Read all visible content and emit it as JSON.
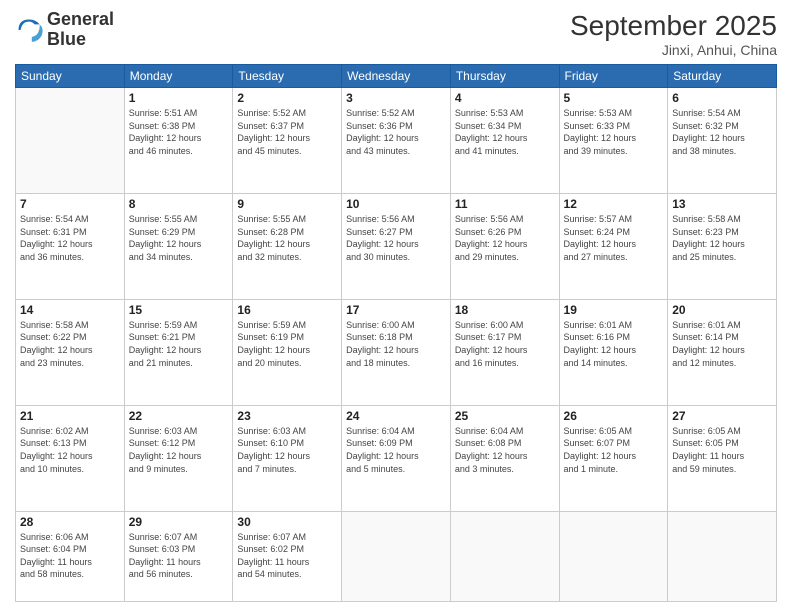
{
  "logo": {
    "line1": "General",
    "line2": "Blue"
  },
  "title": "September 2025",
  "subtitle": "Jinxi, Anhui, China",
  "days_of_week": [
    "Sunday",
    "Monday",
    "Tuesday",
    "Wednesday",
    "Thursday",
    "Friday",
    "Saturday"
  ],
  "weeks": [
    [
      {
        "day": "",
        "info": ""
      },
      {
        "day": "1",
        "info": "Sunrise: 5:51 AM\nSunset: 6:38 PM\nDaylight: 12 hours\nand 46 minutes."
      },
      {
        "day": "2",
        "info": "Sunrise: 5:52 AM\nSunset: 6:37 PM\nDaylight: 12 hours\nand 45 minutes."
      },
      {
        "day": "3",
        "info": "Sunrise: 5:52 AM\nSunset: 6:36 PM\nDaylight: 12 hours\nand 43 minutes."
      },
      {
        "day": "4",
        "info": "Sunrise: 5:53 AM\nSunset: 6:34 PM\nDaylight: 12 hours\nand 41 minutes."
      },
      {
        "day": "5",
        "info": "Sunrise: 5:53 AM\nSunset: 6:33 PM\nDaylight: 12 hours\nand 39 minutes."
      },
      {
        "day": "6",
        "info": "Sunrise: 5:54 AM\nSunset: 6:32 PM\nDaylight: 12 hours\nand 38 minutes."
      }
    ],
    [
      {
        "day": "7",
        "info": "Sunrise: 5:54 AM\nSunset: 6:31 PM\nDaylight: 12 hours\nand 36 minutes."
      },
      {
        "day": "8",
        "info": "Sunrise: 5:55 AM\nSunset: 6:29 PM\nDaylight: 12 hours\nand 34 minutes."
      },
      {
        "day": "9",
        "info": "Sunrise: 5:55 AM\nSunset: 6:28 PM\nDaylight: 12 hours\nand 32 minutes."
      },
      {
        "day": "10",
        "info": "Sunrise: 5:56 AM\nSunset: 6:27 PM\nDaylight: 12 hours\nand 30 minutes."
      },
      {
        "day": "11",
        "info": "Sunrise: 5:56 AM\nSunset: 6:26 PM\nDaylight: 12 hours\nand 29 minutes."
      },
      {
        "day": "12",
        "info": "Sunrise: 5:57 AM\nSunset: 6:24 PM\nDaylight: 12 hours\nand 27 minutes."
      },
      {
        "day": "13",
        "info": "Sunrise: 5:58 AM\nSunset: 6:23 PM\nDaylight: 12 hours\nand 25 minutes."
      }
    ],
    [
      {
        "day": "14",
        "info": "Sunrise: 5:58 AM\nSunset: 6:22 PM\nDaylight: 12 hours\nand 23 minutes."
      },
      {
        "day": "15",
        "info": "Sunrise: 5:59 AM\nSunset: 6:21 PM\nDaylight: 12 hours\nand 21 minutes."
      },
      {
        "day": "16",
        "info": "Sunrise: 5:59 AM\nSunset: 6:19 PM\nDaylight: 12 hours\nand 20 minutes."
      },
      {
        "day": "17",
        "info": "Sunrise: 6:00 AM\nSunset: 6:18 PM\nDaylight: 12 hours\nand 18 minutes."
      },
      {
        "day": "18",
        "info": "Sunrise: 6:00 AM\nSunset: 6:17 PM\nDaylight: 12 hours\nand 16 minutes."
      },
      {
        "day": "19",
        "info": "Sunrise: 6:01 AM\nSunset: 6:16 PM\nDaylight: 12 hours\nand 14 minutes."
      },
      {
        "day": "20",
        "info": "Sunrise: 6:01 AM\nSunset: 6:14 PM\nDaylight: 12 hours\nand 12 minutes."
      }
    ],
    [
      {
        "day": "21",
        "info": "Sunrise: 6:02 AM\nSunset: 6:13 PM\nDaylight: 12 hours\nand 10 minutes."
      },
      {
        "day": "22",
        "info": "Sunrise: 6:03 AM\nSunset: 6:12 PM\nDaylight: 12 hours\nand 9 minutes."
      },
      {
        "day": "23",
        "info": "Sunrise: 6:03 AM\nSunset: 6:10 PM\nDaylight: 12 hours\nand 7 minutes."
      },
      {
        "day": "24",
        "info": "Sunrise: 6:04 AM\nSunset: 6:09 PM\nDaylight: 12 hours\nand 5 minutes."
      },
      {
        "day": "25",
        "info": "Sunrise: 6:04 AM\nSunset: 6:08 PM\nDaylight: 12 hours\nand 3 minutes."
      },
      {
        "day": "26",
        "info": "Sunrise: 6:05 AM\nSunset: 6:07 PM\nDaylight: 12 hours\nand 1 minute."
      },
      {
        "day": "27",
        "info": "Sunrise: 6:05 AM\nSunset: 6:05 PM\nDaylight: 11 hours\nand 59 minutes."
      }
    ],
    [
      {
        "day": "28",
        "info": "Sunrise: 6:06 AM\nSunset: 6:04 PM\nDaylight: 11 hours\nand 58 minutes."
      },
      {
        "day": "29",
        "info": "Sunrise: 6:07 AM\nSunset: 6:03 PM\nDaylight: 11 hours\nand 56 minutes."
      },
      {
        "day": "30",
        "info": "Sunrise: 6:07 AM\nSunset: 6:02 PM\nDaylight: 11 hours\nand 54 minutes."
      },
      {
        "day": "",
        "info": ""
      },
      {
        "day": "",
        "info": ""
      },
      {
        "day": "",
        "info": ""
      },
      {
        "day": "",
        "info": ""
      }
    ]
  ]
}
